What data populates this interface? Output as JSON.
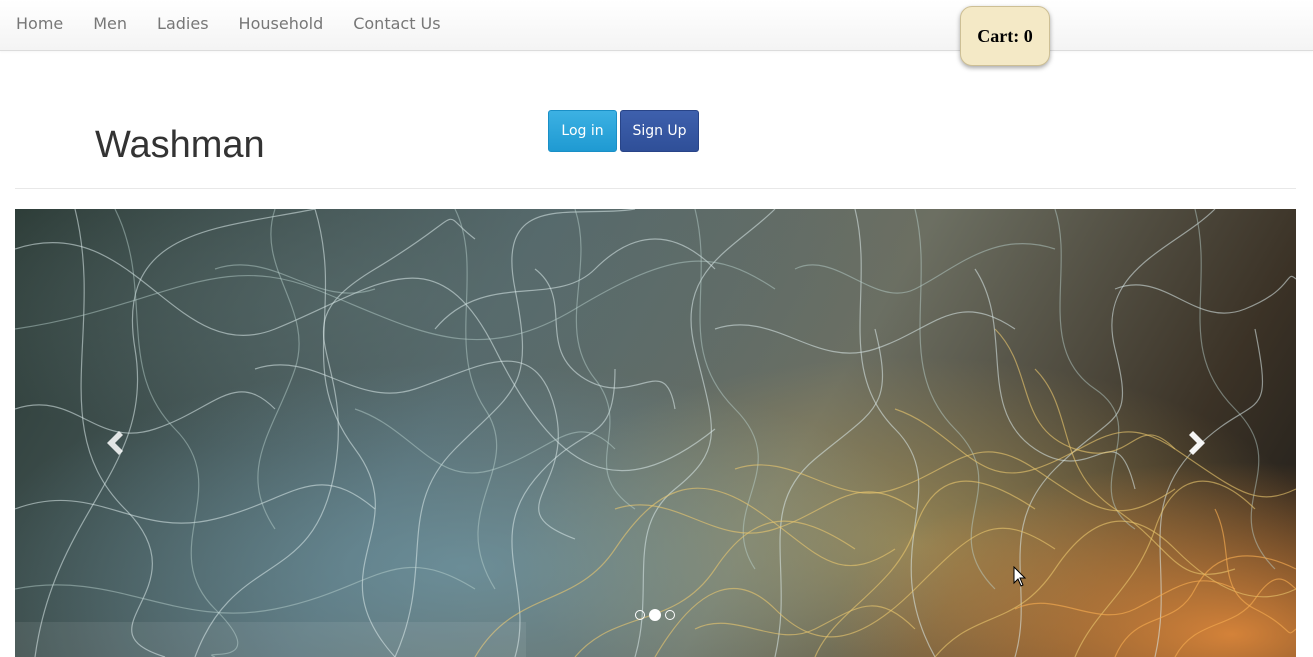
{
  "nav": {
    "items": [
      {
        "label": "Home"
      },
      {
        "label": "Men"
      },
      {
        "label": "Ladies"
      },
      {
        "label": "Household"
      },
      {
        "label": "Contact Us"
      }
    ],
    "cart_label": "Cart: 0"
  },
  "header": {
    "title": "Washman",
    "login_label": "Log in",
    "signup_label": "Sign Up"
  },
  "carousel": {
    "slide_count": 3,
    "active_slide": 2,
    "prev_icon": "chevron-left-icon",
    "next_icon": "chevron-right-icon"
  },
  "colors": {
    "login_button": "#1f9ad2",
    "signup_button": "#2f4f98",
    "cart_background": "#f4e9c6",
    "nav_text": "#777777"
  }
}
